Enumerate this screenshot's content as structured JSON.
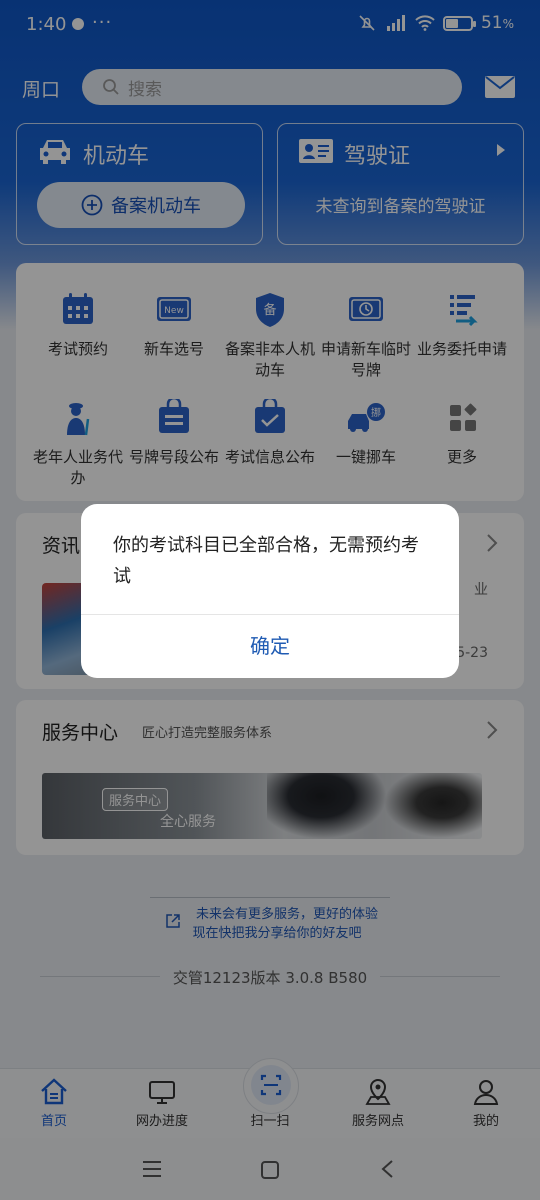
{
  "status_bar": {
    "time": "1:40",
    "more": "···",
    "battery": "51",
    "battery_level": 0.51
  },
  "header": {
    "city": "周口",
    "search_placeholder": "搜索"
  },
  "vehicle_card": {
    "title": "机动车",
    "button": "备案机动车"
  },
  "license_card": {
    "title": "驾驶证",
    "empty_text": "未查询到备案的驾驶证"
  },
  "services": [
    {
      "label": "考试预约",
      "icon": "calendar-icon"
    },
    {
      "label": "新车选号",
      "icon": "new-plate-icon"
    },
    {
      "label": "备案非本人机动车",
      "icon": "shield-filing-icon"
    },
    {
      "label": "申请新车临时号牌",
      "icon": "temp-plate-icon"
    },
    {
      "label": "业务委托申请",
      "icon": "delegate-icon"
    },
    {
      "label": "老年人业务代办",
      "icon": "elderly-icon"
    },
    {
      "label": "号牌号段公布",
      "icon": "plate-range-icon"
    },
    {
      "label": "考试信息公布",
      "icon": "exam-info-icon"
    },
    {
      "label": "一键挪车",
      "icon": "move-car-icon"
    },
    {
      "label": "更多",
      "icon": "more-grid-icon"
    }
  ],
  "news": {
    "title": "资讯",
    "frag_top": "业",
    "frag_date": "5-23"
  },
  "service_center": {
    "title": "服务中心",
    "subtitle": "匠心打造完整服务体系",
    "banner_tag": "服务中心",
    "banner_sub": "全心服务"
  },
  "footer": {
    "share_line1": "未来会有更多服务，更好的体验",
    "share_line2": "现在快把我分享给你的好友吧",
    "version": "交管12123版本 3.0.8 B580"
  },
  "tabbar": [
    {
      "label": "首页",
      "icon": "home-icon"
    },
    {
      "label": "网办进度",
      "icon": "monitor-icon"
    },
    {
      "label": "扫一扫",
      "icon": "scan-icon"
    },
    {
      "label": "服务网点",
      "icon": "map-pin-icon"
    },
    {
      "label": "我的",
      "icon": "user-icon"
    }
  ],
  "dialog": {
    "message": "你的考试科目已全部合格，无需预约考试",
    "confirm": "确定"
  },
  "colors": {
    "brand_blue": "#1a5ed0",
    "dialog_button": "#1f5bb3"
  }
}
